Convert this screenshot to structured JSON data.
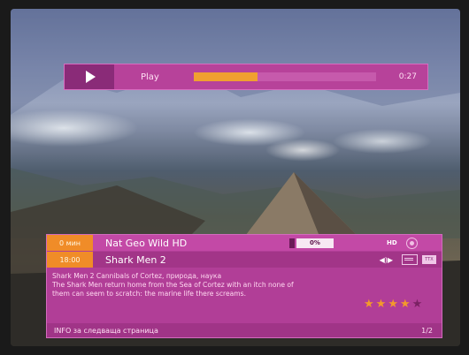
{
  "player": {
    "state_label": "Play",
    "elapsed": "0:27",
    "progress": 0.35
  },
  "info": {
    "row1": {
      "tag": "0 мин",
      "channel": "Nat Geo Wild HD",
      "signal_label": "0%",
      "hd_label": "HD"
    },
    "row2": {
      "tag": "18:00",
      "program": "Shark Men 2",
      "audio_label": "◀)▶",
      "teletext_label": "TTX"
    },
    "description_line1": "Shark Men 2 Cannibals of Cortez, природа, наука",
    "description_line2": "The Shark Men return home from the Sea of Cortez with an itch none of",
    "description_line3": "them can seem to scratch: the marine life there screams.",
    "rating": {
      "filled": 4,
      "total": 5
    },
    "footer_text": "INFO за следваща страница",
    "page_indicator": "1/2"
  },
  "colors": {
    "banner": "#b13e97",
    "accent": "#f08c28",
    "progress_fill": "#f0a030"
  }
}
